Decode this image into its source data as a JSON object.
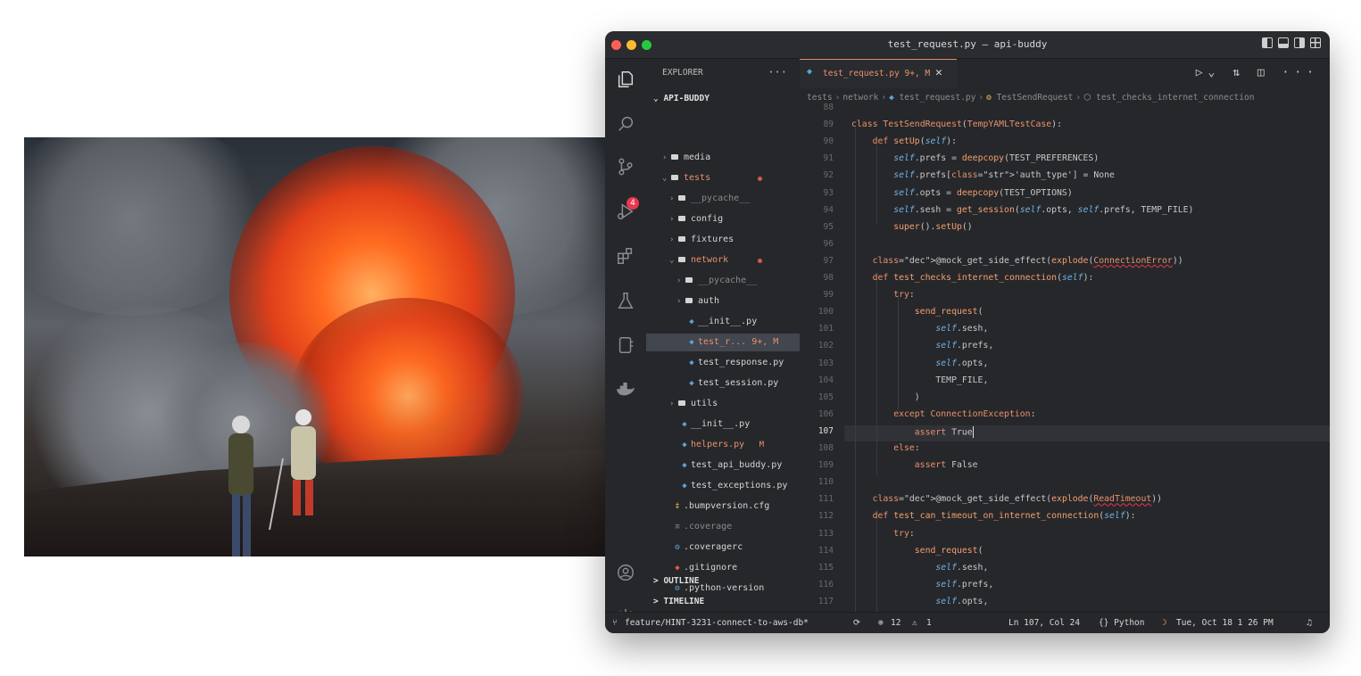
{
  "window": {
    "title": "test_request.py — api-buddy"
  },
  "explorer": {
    "header": "EXPLORER",
    "more": "···",
    "root": "API-BUDDY",
    "items": [
      {
        "twisty": ">",
        "label": "media",
        "kind": "folder"
      },
      {
        "twisty": "v",
        "label": "tests",
        "kind": "folder",
        "modified": true
      },
      {
        "twisty": ">",
        "label": "__pycache__",
        "kind": "folder",
        "dim": true
      },
      {
        "twisty": ">",
        "label": "config",
        "kind": "folder"
      },
      {
        "twisty": ">",
        "label": "fixtures",
        "kind": "folder"
      },
      {
        "twisty": "v",
        "label": "network",
        "kind": "folder",
        "modified": true
      },
      {
        "twisty": ">",
        "label": "__pycache__",
        "kind": "folder",
        "dim": true
      },
      {
        "twisty": ">",
        "label": "auth",
        "kind": "folder"
      },
      {
        "twisty": "",
        "label": "__init__.py",
        "kind": "py"
      },
      {
        "twisty": "",
        "label": "test_r...  9+, M",
        "kind": "py",
        "selected": true,
        "modified": true
      },
      {
        "twisty": "",
        "label": "test_response.py",
        "kind": "py"
      },
      {
        "twisty": "",
        "label": "test_session.py",
        "kind": "py"
      },
      {
        "twisty": ">",
        "label": "utils",
        "kind": "folder"
      },
      {
        "twisty": "",
        "label": "__init__.py",
        "kind": "py"
      },
      {
        "twisty": "",
        "label": "helpers.py",
        "kind": "py",
        "modified": true,
        "flag": "M"
      },
      {
        "twisty": "",
        "label": "test_api_buddy.py",
        "kind": "py"
      },
      {
        "twisty": "",
        "label": "test_exceptions.py",
        "kind": "py"
      },
      {
        "twisty": "",
        "label": ".bumpversion.cfg",
        "kind": "cfg"
      },
      {
        "twisty": "",
        "label": ".coverage",
        "kind": "file",
        "dim": true
      },
      {
        "twisty": "",
        "label": ".coveragerc",
        "kind": "gear"
      },
      {
        "twisty": "",
        "label": ".gitignore",
        "kind": "git"
      },
      {
        "twisty": "",
        "label": ".python-version",
        "kind": "gear"
      }
    ],
    "outline": "OUTLINE",
    "timeline": "TIMELINE"
  },
  "tab": {
    "label": "test_request.py 9+, M",
    "close": "✕"
  },
  "editor_actions": "▷⌄ ⇅ ◫ ···",
  "breadcrumb": {
    "parts": [
      "tests",
      "network",
      "test_request.py",
      "TestSendRequest",
      "test_checks_internet_connection"
    ]
  },
  "code": {
    "line_numbers": [
      "88",
      "89",
      "90",
      "91",
      "92",
      "93",
      "94",
      "95",
      "96",
      "97",
      "98",
      "99",
      "100",
      "101",
      "102",
      "103",
      "104",
      "105",
      "106",
      "107",
      "108",
      "109",
      "110",
      "111",
      "112",
      "113",
      "114",
      "115",
      "116",
      "117"
    ],
    "current_line": "107",
    "lines": [
      "",
      "class TestSendRequest(TempYAMLTestCase):",
      "    def setUp(self):",
      "        self.prefs = deepcopy(TEST_PREFERENCES)",
      "        self.prefs['auth_type'] = None",
      "        self.opts = deepcopy(TEST_OPTIONS)",
      "        self.sesh = get_session(self.opts, self.prefs, TEMP_FILE)",
      "        super().setUp()",
      "",
      "    @mock_get_side_effect(explode(ConnectionError))",
      "    def test_checks_internet_connection(self):",
      "        try:",
      "            send_request(",
      "                self.sesh,",
      "                self.prefs,",
      "                self.opts,",
      "                TEMP_FILE,",
      "            )",
      "        except ConnectionException:",
      "            assert True",
      "        else:",
      "            assert False",
      "",
      "    @mock_get_side_effect(explode(ReadTimeout))",
      "    def test_can_timeout_on_internet_connection(self):",
      "        try:",
      "            send_request(",
      "                self.sesh,",
      "                self.prefs,",
      "                self.opts,"
    ]
  },
  "status": {
    "branch": "feature/HINT-3231-connect-to-aws-db*",
    "errors": "12",
    "warnings": "1",
    "position": "Ln 107, Col 24",
    "language": "{} Python",
    "clock": "Tue, Oct 18 1 26 PM"
  },
  "colors": {
    "accent": "#e8926a",
    "selection": "#41464f",
    "background": "#26272b"
  }
}
